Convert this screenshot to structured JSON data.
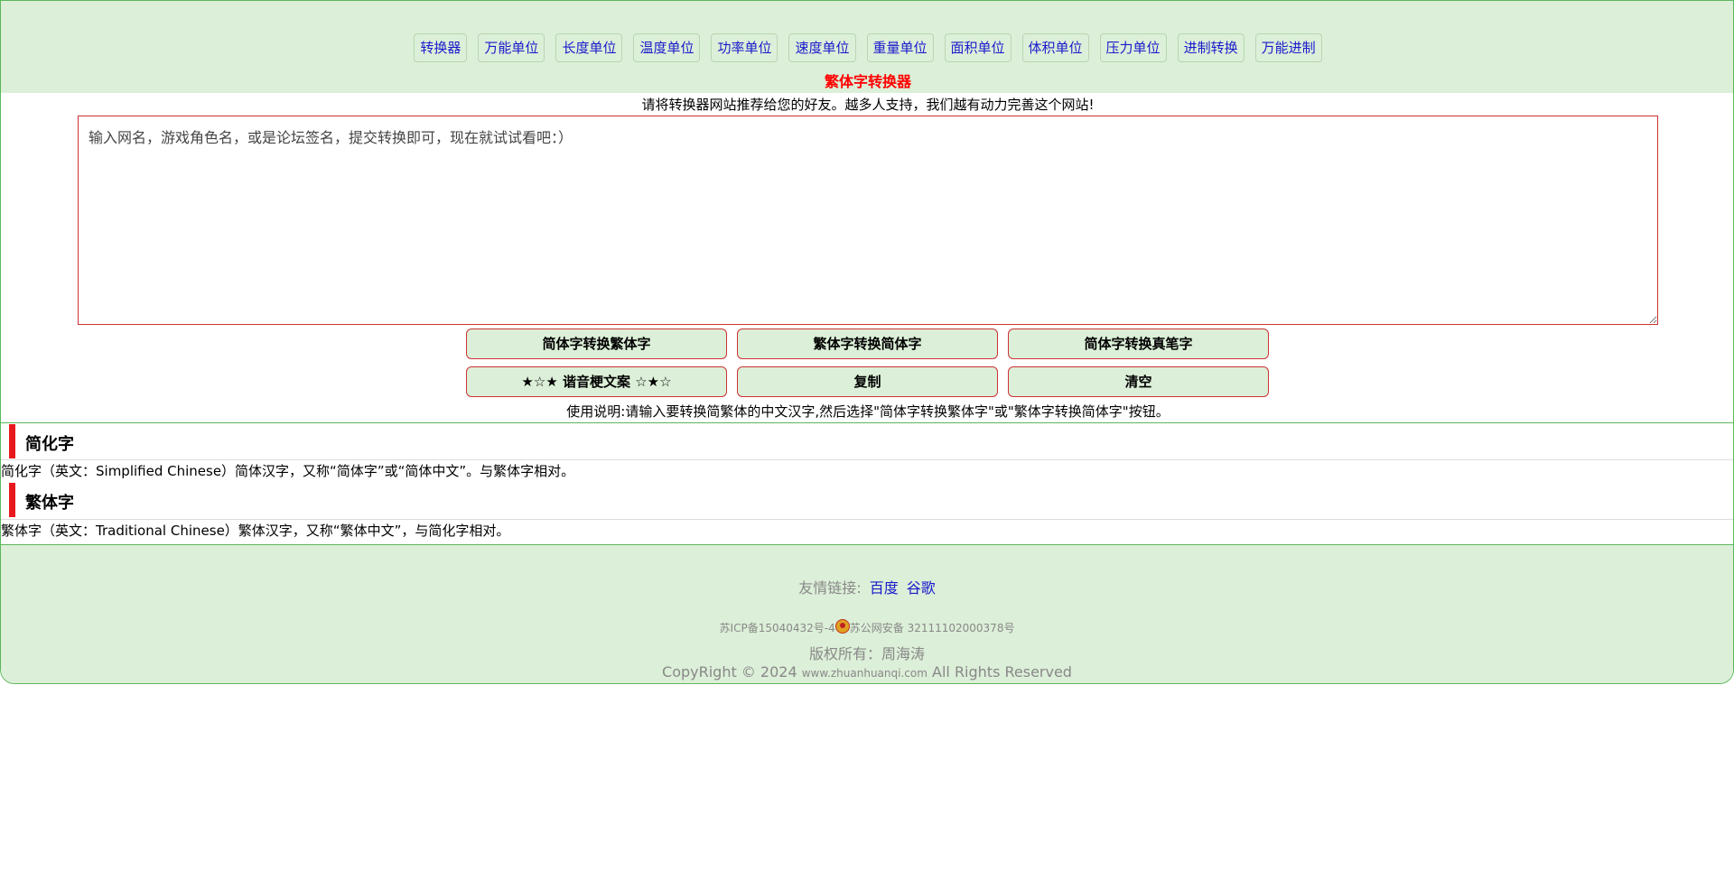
{
  "nav": {
    "items": [
      "转换器",
      "万能单位",
      "长度单位",
      "温度单位",
      "功率单位",
      "速度单位",
      "重量单位",
      "面积单位",
      "体积单位",
      "压力单位",
      "进制转换",
      "万能进制"
    ]
  },
  "title": "繁体字转换器",
  "recommend": "请将转换器网站推荐给您的好友。越多人支持，我们越有动力完善这个网站!",
  "input": {
    "placeholder": "输入网名，游戏角色名，或是论坛签名，提交转换即可，现在就试试看吧：）"
  },
  "buttons": {
    "to_traditional": "简体字转换繁体字",
    "to_simplified": "繁体字转换简体字",
    "to_calligraphy": "简体字转换真笔字",
    "homophone": "★☆★ 谐音梗文案 ☆★☆",
    "copy": "复制",
    "clear": "清空"
  },
  "usage": "使用说明:请输入要转换简繁体的中文汉字,然后选择\"简体字转换繁体字\"或\"繁体字转换简体字\"按钮。",
  "sections": [
    {
      "heading": "简化字",
      "text": "简化字（英文：Simplified Chinese）简体汉字，又称“简体字”或“简体中文”。与繁体字相对。"
    },
    {
      "heading": "繁体字",
      "text": "繁体字（英文：Traditional Chinese）繁体汉字，又称“繁体中文”，与简化字相对。"
    }
  ],
  "footer": {
    "links_label": "友情链接:",
    "links": [
      "百度",
      "谷歌"
    ],
    "icp": "苏ICP备15040432号-4",
    "police": "苏公网安备 32111102000378号",
    "owner": "版权所有：周海涛",
    "copyright_prefix": "CopyRight © 2024",
    "domain": "www.zhuanhuanqi.com",
    "copyright_suffix": "All Rights Reserved"
  }
}
